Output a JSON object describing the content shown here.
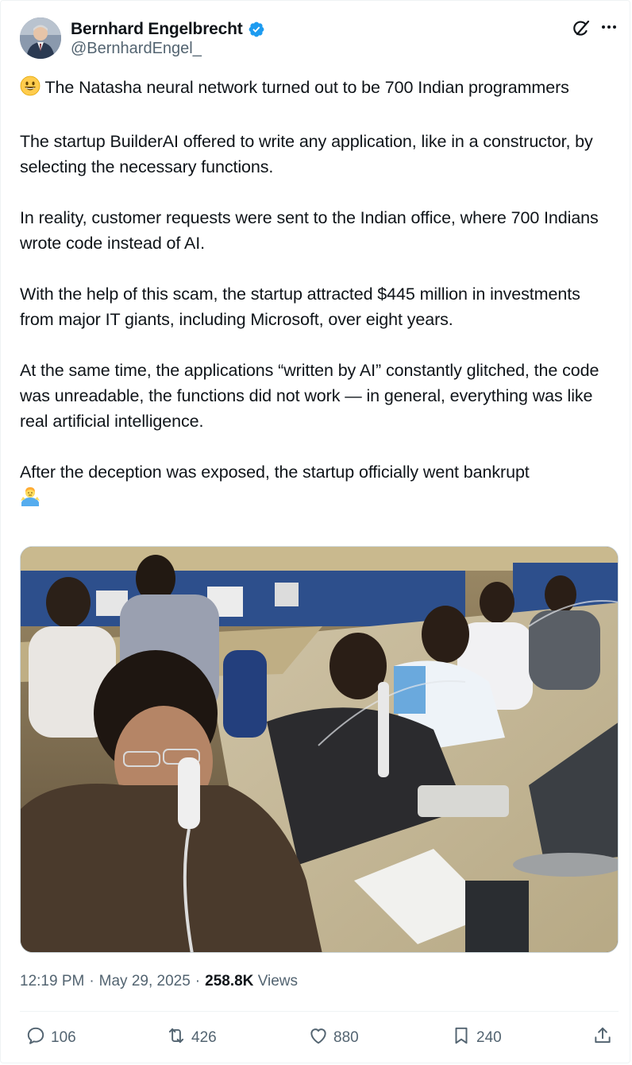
{
  "author": {
    "name": "Bernhard Engelbrecht",
    "handle": "@BernhardEngel_",
    "verified_color": "#1d9bf0"
  },
  "tweet": {
    "paragraphs": [
      {
        "emoji": "grinning-face-emoji",
        "text": "The Natasha neural network turned out to be 700 Indian programmers"
      },
      {
        "text": "The startup BuilderAI offered to write any application, like in a constructor, by selecting the necessary functions."
      },
      {
        "text": "In reality, customer requests were sent to the Indian office, where 700 Indians wrote code instead of AI."
      },
      {
        "text": "With the help of this scam, the startup attracted $445 million in investments from major IT giants, including Microsoft, over eight years."
      },
      {
        "text": "At the same time, the applications “written by AI” constantly glitched, the code was unreadable, the functions did not work — in general, everything was like real artificial intelligence."
      },
      {
        "text": "After the deception was exposed, the startup officially went bankrupt",
        "trailing_emoji": "man-shrugging-emoji"
      }
    ],
    "media_description_icon": "photo-call-center"
  },
  "meta": {
    "time": "12:19 PM",
    "sep1": "·",
    "date": "May 29, 2025",
    "sep2": "·",
    "views_count": "258.8K",
    "views_label": "Views"
  },
  "actions": {
    "replies": "106",
    "reposts": "426",
    "likes": "880",
    "bookmarks": "240"
  },
  "colors": {
    "text": "#0f1419",
    "secondary": "#536471",
    "accent": "#1d9bf0"
  }
}
